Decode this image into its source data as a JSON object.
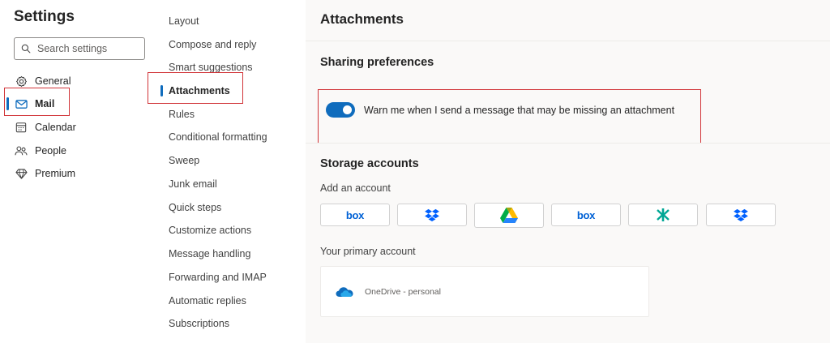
{
  "settings": {
    "title": "Settings",
    "search_placeholder": "Search settings",
    "categories": [
      {
        "label": "General",
        "icon": "gear-icon"
      },
      {
        "label": "Mail",
        "icon": "mail-icon",
        "selected": true
      },
      {
        "label": "Calendar",
        "icon": "calendar-icon"
      },
      {
        "label": "People",
        "icon": "people-icon"
      },
      {
        "label": "Premium",
        "icon": "diamond-icon"
      }
    ]
  },
  "mail_nav": {
    "items": [
      {
        "label": "Layout"
      },
      {
        "label": "Compose and reply"
      },
      {
        "label": "Smart suggestions"
      },
      {
        "label": "Attachments",
        "selected": true
      },
      {
        "label": "Rules"
      },
      {
        "label": "Conditional formatting"
      },
      {
        "label": "Sweep"
      },
      {
        "label": "Junk email"
      },
      {
        "label": "Quick steps"
      },
      {
        "label": "Customize actions"
      },
      {
        "label": "Message handling"
      },
      {
        "label": "Forwarding and IMAP"
      },
      {
        "label": "Automatic replies"
      },
      {
        "label": "Subscriptions"
      }
    ]
  },
  "content": {
    "title": "Attachments",
    "sharing": {
      "heading": "Sharing preferences",
      "toggle_label": "Warn me when I send a message that may be missing an attachment",
      "toggle_on": true
    },
    "storage": {
      "heading": "Storage accounts",
      "add_label": "Add an account",
      "providers": [
        {
          "name": "box",
          "icon": "box-logo-icon"
        },
        {
          "name": "Dropbox",
          "icon": "dropbox-icon"
        },
        {
          "name": "Google Drive",
          "icon": "google-drive-icon"
        },
        {
          "name": "box",
          "icon": "box-logo-icon"
        },
        {
          "name": "Egnyte",
          "icon": "egnyte-icon"
        },
        {
          "name": "Dropbox",
          "icon": "dropbox-icon"
        }
      ],
      "primary_label": "Your primary account",
      "primary_account": "OneDrive - personal"
    }
  },
  "colors": {
    "accent": "#0f6cbd",
    "highlight_box": "#d13438",
    "content_bg": "#faf9f8"
  }
}
